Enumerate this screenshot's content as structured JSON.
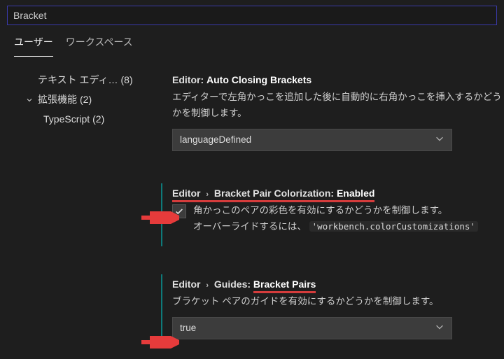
{
  "search": {
    "value": "Bracket"
  },
  "tabs": {
    "user": "ユーザー",
    "workspace": "ワークスペース"
  },
  "sidebar": {
    "textEditor": {
      "label": "テキスト エディ…",
      "count": "(8)"
    },
    "extensions": {
      "label": "拡張機能",
      "count": "(2)"
    },
    "typescript": {
      "label": "TypeScript",
      "count": "(2)"
    }
  },
  "settings": {
    "autoclose": {
      "path": "Editor:",
      "name": "Auto Closing Brackets",
      "desc": "エディターで左角かっこを追加した後に自動的に右角かっこを挿入するかどうかを制御します。",
      "select": {
        "value": "languageDefined"
      }
    },
    "colorization": {
      "path": "Editor",
      "group": "Bracket Pair Colorization:",
      "name": "Enabled",
      "desc1": "角かっこのペアの彩色を有効にするかどうかを制御します。",
      "desc2_pre": "オーバーライドするには、",
      "desc2_literal": "'workbench.colorCustomizations'",
      "checked": true
    },
    "guides": {
      "path": "Editor",
      "group": "Guides:",
      "name": "Bracket Pairs",
      "desc": "ブラケット ペアのガイドを有効にするかどうかを制御します。",
      "select": {
        "value": "true"
      }
    }
  }
}
